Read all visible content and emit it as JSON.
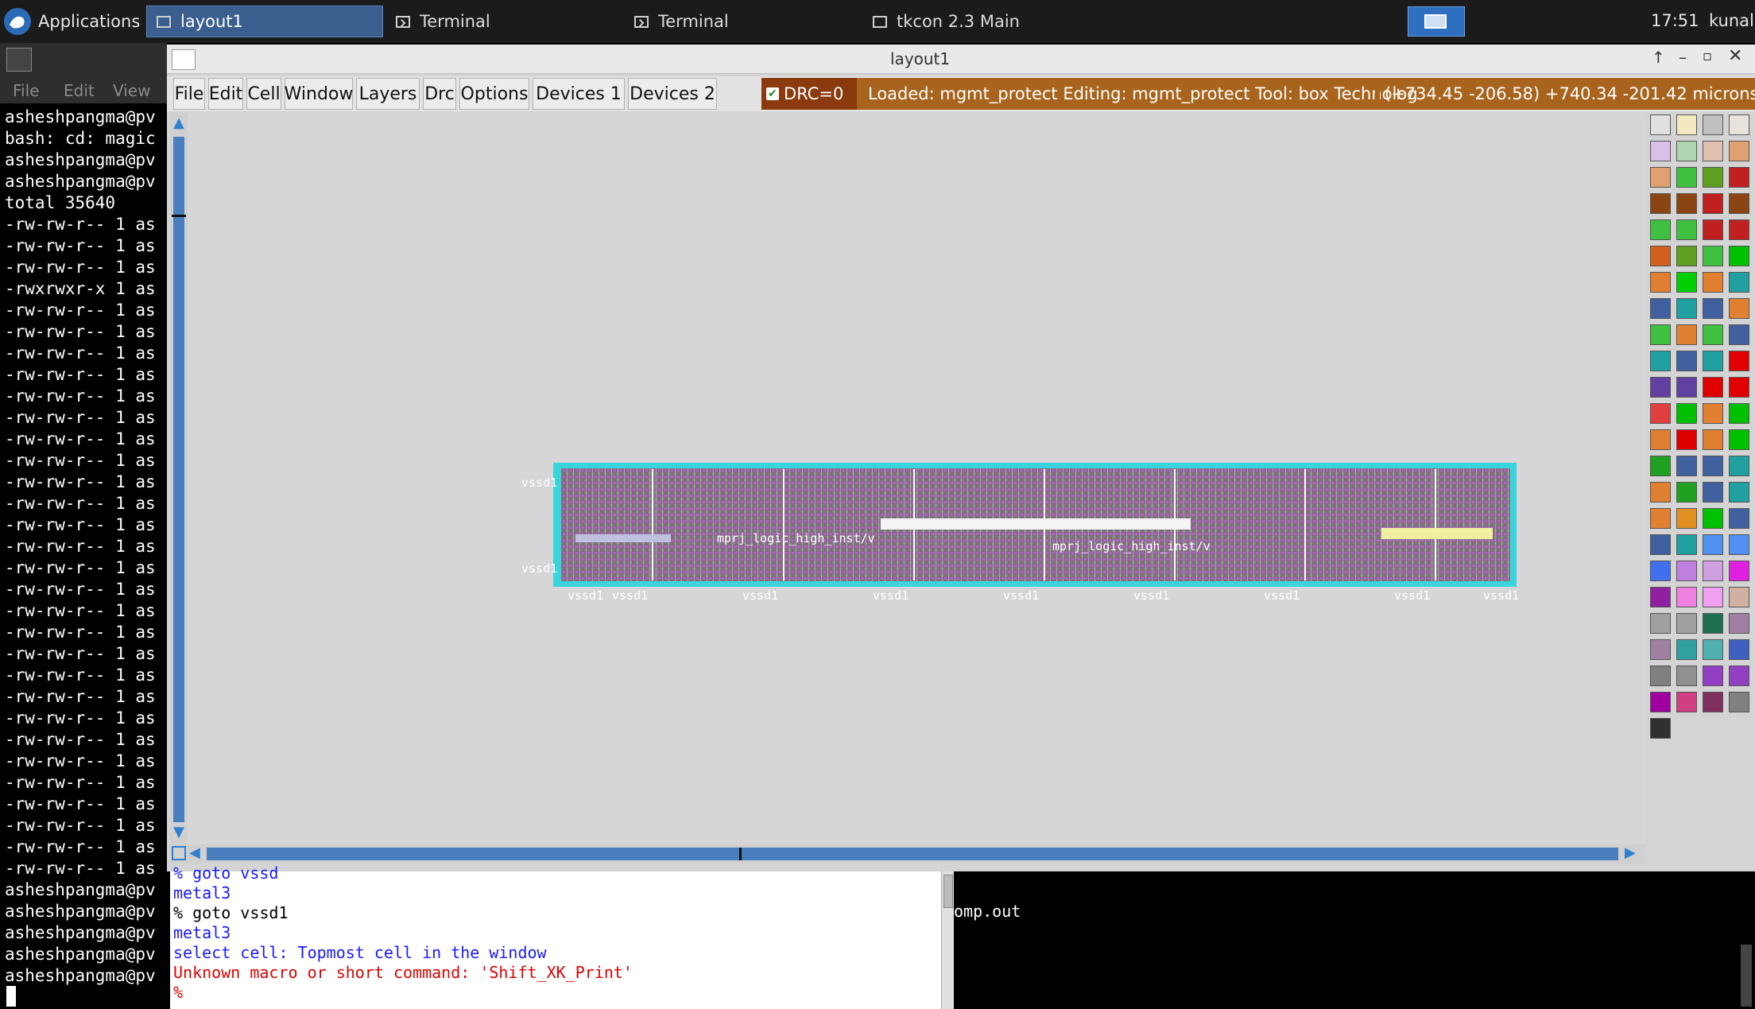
{
  "taskbar": {
    "apps_label": "Applications",
    "tasks": [
      "layout1",
      "Terminal",
      "Terminal",
      "tkcon 2.3 Main"
    ],
    "clock": "17:51",
    "user": "kunal("
  },
  "terminal_left": {
    "menu": [
      "File",
      "Edit",
      "View"
    ],
    "lines": [
      "asheshpangma@pv",
      "bash: cd: magic",
      "asheshpangma@pv",
      "asheshpangma@pv",
      "total 35640",
      "-rw-rw-r-- 1 as",
      "-rw-rw-r-- 1 as",
      "-rw-rw-r-- 1 as",
      "-rwxrwxr-x 1 as",
      "-rw-rw-r-- 1 as",
      "-rw-rw-r-- 1 as",
      "-rw-rw-r-- 1 as",
      "-rw-rw-r-- 1 as",
      "-rw-rw-r-- 1 as",
      "-rw-rw-r-- 1 as",
      "-rw-rw-r-- 1 as",
      "-rw-rw-r-- 1 as",
      "-rw-rw-r-- 1 as",
      "-rw-rw-r-- 1 as",
      "-rw-rw-r-- 1 as",
      "-rw-rw-r-- 1 as",
      "-rw-rw-r-- 1 as",
      "-rw-rw-r-- 1 as",
      "-rw-rw-r-- 1 as",
      "-rw-rw-r-- 1 as",
      "-rw-rw-r-- 1 as",
      "-rw-rw-r-- 1 as",
      "-rw-rw-r-- 1 as",
      "-rw-rw-r-- 1 as",
      "-rw-rw-r-- 1 as",
      "-rw-rw-r-- 1 as",
      "-rw-rw-r-- 1 as",
      "-rw-rw-r-- 1 as",
      "-rw-rw-r-- 1 as",
      "-rw-rw-r-- 1 as",
      "-rw-rw-r-- 1 as",
      "asheshpangma@pv",
      "asheshpangma@pv",
      "asheshpangma@pv",
      "asheshpangma@pv",
      "asheshpangma@pv"
    ]
  },
  "layout_window": {
    "title": "layout1",
    "menu": [
      "File",
      "Edit",
      "Cell",
      "Window",
      "Layers",
      "Drc",
      "Options",
      "Devices 1",
      "Devices 2"
    ],
    "drc_label": "DRC=0",
    "status_text": "Loaded: mgmt_protect Editing: mgmt_protect Tool: box  Technolog",
    "coords": "(+734.45 -206.58) +740.34 -201.42 microns",
    "net_label": "vssd1",
    "cell_label": "mprj_logic_high_inst/v",
    "palette_colors": [
      "#e0e0e0",
      "#f2e8c0",
      "#c0c0c0",
      "#e8e4dc",
      "#d8c0e8",
      "#b0d8b0",
      "#e0c0b0",
      "#e0a070",
      "#e0a070",
      "#40c040",
      "#60a020",
      "#c02020",
      "#8b4513",
      "#8b4513",
      "#c02020",
      "#8b4513",
      "#40c040",
      "#40c040",
      "#c02020",
      "#c02020",
      "#d06020",
      "#60a020",
      "#40c040",
      "#00c000",
      "#e08030",
      "#00d000",
      "#e08030",
      "#20a0a0",
      "#4060a0",
      "#20a0a0",
      "#4060a0",
      "#e08030",
      "#40c040",
      "#e08030",
      "#40c040",
      "#4060a0",
      "#20a0a0",
      "#4060a0",
      "#20a0a0",
      "#e00000",
      "#6040a0",
      "#6040a0",
      "#e00000",
      "#e00000",
      "#e04040",
      "#00c000",
      "#e08030",
      "#00c000",
      "#e08030",
      "#e00000",
      "#e08030",
      "#00c000",
      "#20a020",
      "#4060a0",
      "#4060a0",
      "#20a0a0",
      "#e08030",
      "#20a020",
      "#4060a0",
      "#20a0a0",
      "#e08030",
      "#e09020",
      "#00c000",
      "#4060a0",
      "#4060a0",
      "#20a0a0",
      "#5090f0",
      "#5090f0",
      "#4070f0",
      "#c080e0",
      "#d0a0e0",
      "#e020e0",
      "#9020a0",
      "#f080e0",
      "#f0a0f0",
      "#d0b0a0",
      "#a0a0a0",
      "#a0a0a0",
      "#207050",
      "#a080a0",
      "#a080a0",
      "#30a0a0",
      "#50b0b0",
      "#4060c0",
      "#808080",
      "#909090",
      "#9040c0",
      "#9040c0",
      "#a000a0",
      "#d04080",
      "#803060",
      "#808080",
      "#303030"
    ]
  },
  "console": {
    "lines": [
      {
        "text": "% goto vssd",
        "color": "#1a1aff"
      },
      {
        "text": "metal3",
        "color": "#1a1aff"
      },
      {
        "text": "% goto vssd1",
        "color": "#000000"
      },
      {
        "text": "metal3",
        "color": "#1a1aff"
      },
      {
        "text": "select cell: Topmost cell in the window",
        "color": "#1a1aff"
      },
      {
        "text": "Unknown macro or short command: 'Shift_XK_Print'",
        "color": "#e00000"
      },
      {
        "text": "%",
        "color": "#e00000"
      }
    ]
  },
  "terminal_right": {
    "text": "omp.out"
  }
}
